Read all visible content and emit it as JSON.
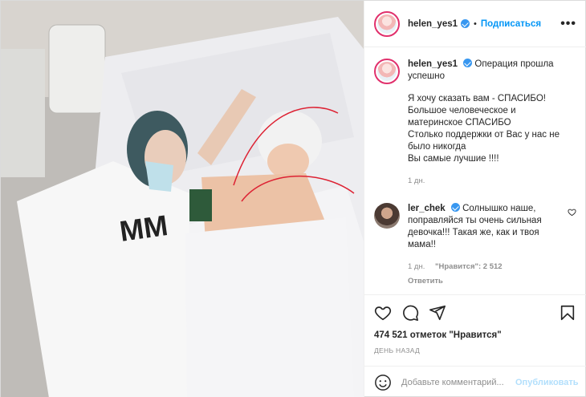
{
  "post": {
    "photo_alt": "hospital photo",
    "username": "helen_yes1",
    "separator": "•",
    "follow_label": "Подписаться",
    "more_label": "•••"
  },
  "caption": {
    "username": "helen_yes1",
    "first_line": "Операция прошла успешно ",
    "lines": [
      "Я хочу сказать вам - СПАСИБО!",
      "Большое человеческое и материнское СПАСИБО ",
      "Столько поддержки от Вас у нас не было никогда ",
      "Вы самые лучшие !!!!"
    ],
    "time": "1 дн."
  },
  "comment": {
    "username": "ler_chek",
    "text": "Солнышко наше, поправляйся  ты очень сильная девочка!!! Такая же, как и твоя мама!!",
    "time": "1 дн.",
    "likes": "\"Нравится\": 2 512",
    "reply_label": "Ответить"
  },
  "actions": {
    "likes_text": "474 521 отметок \"Нравится\"",
    "date_text": "День назад",
    "comment_placeholder": "Добавьте комментарий...",
    "publish_label": "Опубликовать"
  },
  "colors": {
    "link_blue": "#0095f6",
    "verified_blue": "#3897f0",
    "muted": "#8e8e8e"
  },
  "icons": [
    "like-icon",
    "comment-icon",
    "share-icon",
    "save-icon",
    "emoji-icon",
    "verified-icon",
    "heart-small-icon"
  ]
}
